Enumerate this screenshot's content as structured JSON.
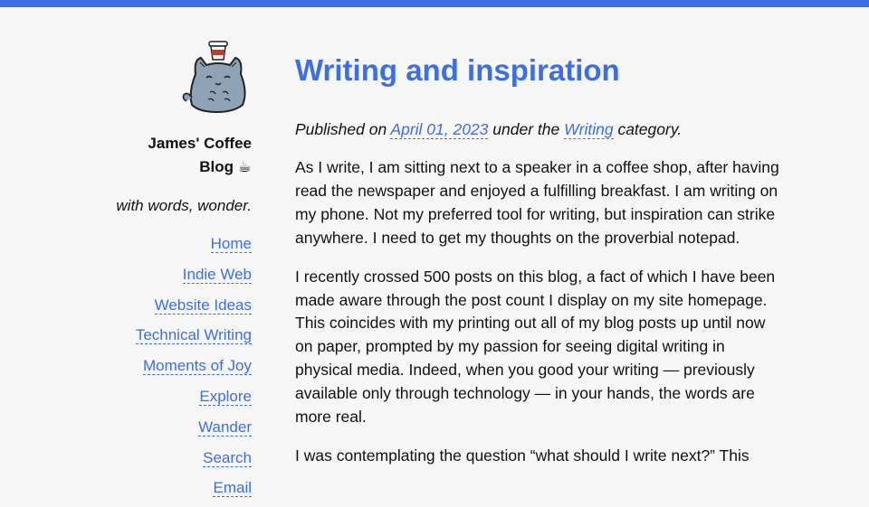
{
  "accent_color": "#3c6ee6",
  "sidebar": {
    "logo_icon": "cat-with-coffee-cup-icon",
    "title_line1": "James' Coffee",
    "title_line2": "Blog ☕",
    "tagline": "with words, wonder.",
    "nav": [
      {
        "label": "Home"
      },
      {
        "label": "Indie Web"
      },
      {
        "label": "Website Ideas"
      },
      {
        "label": "Technical Writing"
      },
      {
        "label": "Moments of Joy"
      },
      {
        "label": "Explore"
      },
      {
        "label": "Wander"
      },
      {
        "label": "Search"
      },
      {
        "label": "Email"
      }
    ]
  },
  "post": {
    "title": "Writing and inspiration",
    "meta_prefix": "Published on",
    "date": "April 01, 2023",
    "meta_mid": "under the",
    "category": "Writing",
    "meta_suffix": "category.",
    "paragraphs": [
      "As I write, I am sitting next to a speaker in a coffee shop, after having read the newspaper and enjoyed a fulfilling breakfast. I am writing on my phone. Not my preferred tool for writing, but inspiration can strike anywhere. I need to get my thoughts on the proverbial notepad.",
      "I recently crossed 500 posts on this blog, a fact of which I have been made aware through the post count I display on my site homepage. This coincides with my printing out all of my blog posts up until now on paper, prompted by my passion for seeing digital writing in physical media. Indeed, when you good your writing — previously available only through technology — in your hands, the words are more real.",
      "I was contemplating the question “what should I write next?” This"
    ]
  }
}
